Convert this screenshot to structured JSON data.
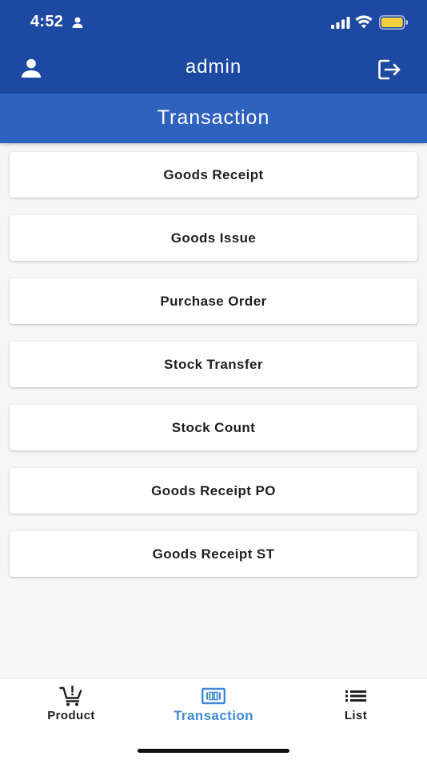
{
  "status_bar": {
    "time": "4:52"
  },
  "app_bar": {
    "title": "admin"
  },
  "section": {
    "title": "Transaction"
  },
  "menu": {
    "items": [
      {
        "label": "Goods Receipt"
      },
      {
        "label": "Goods Issue"
      },
      {
        "label": "Purchase Order"
      },
      {
        "label": "Stock Transfer"
      },
      {
        "label": "Stock Count"
      },
      {
        "label": "Goods Receipt PO"
      },
      {
        "label": "Goods Receipt ST"
      }
    ]
  },
  "bottom_nav": {
    "items": [
      {
        "label": "Product",
        "icon": "cart-icon"
      },
      {
        "label": "Transaction",
        "icon": "barcode-icon",
        "active": true
      },
      {
        "label": "List",
        "icon": "list-icon"
      }
    ]
  },
  "colors": {
    "app_bar": "#1e49a3",
    "section_header": "#2f61be",
    "active_nav": "#3e8ad6",
    "battery": "#f4d03f"
  }
}
